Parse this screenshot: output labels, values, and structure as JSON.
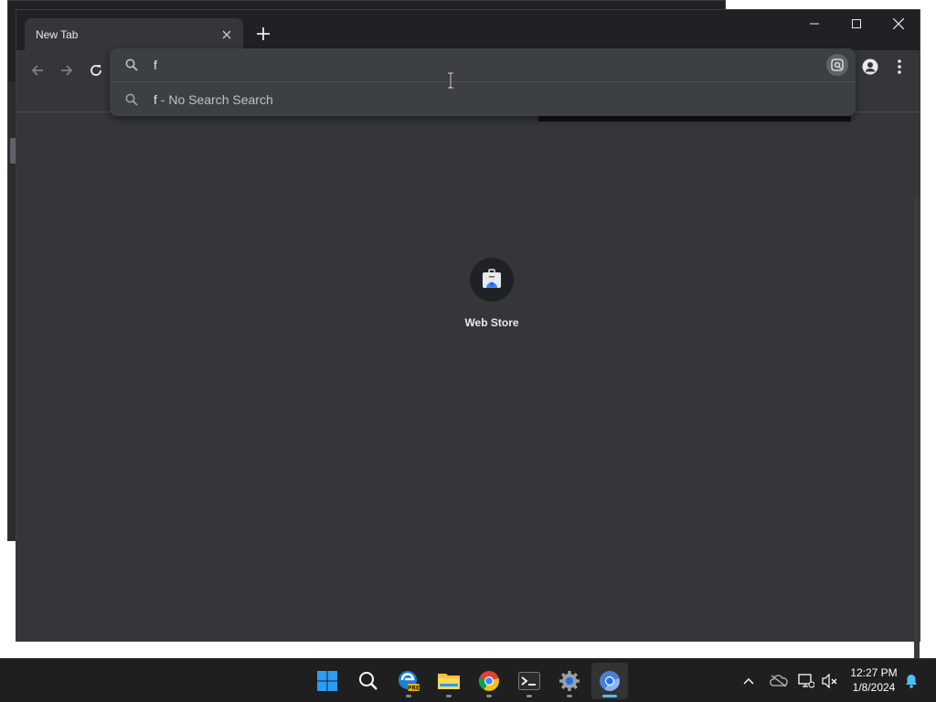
{
  "browser": {
    "tab": {
      "title": "New Tab"
    },
    "window_controls": [
      "minimize",
      "maximize",
      "close"
    ]
  },
  "omnibox": {
    "value": "f",
    "suggestion": {
      "query": "f",
      "separator": " - ",
      "engine": "No Search Search"
    }
  },
  "shortcuts": [
    {
      "label": "Web Store",
      "icon": "web-store-icon"
    }
  ],
  "taskbar": {
    "apps": [
      "start-icon",
      "search-icon",
      "edge-beta-icon",
      "file-explorer-icon",
      "chrome-icon",
      "terminal-icon",
      "settings-icon",
      "chromium-icon"
    ],
    "clock": {
      "time": "12:27 PM",
      "date": "1/8/2024"
    }
  },
  "colors": {
    "chrome_dark": "#35363a",
    "titlebar": "#202124",
    "omnibox_bg": "#3c4043",
    "text": "#e8eaed",
    "taskbar": "#1f1f1f",
    "accent": "#4cc2ff"
  }
}
